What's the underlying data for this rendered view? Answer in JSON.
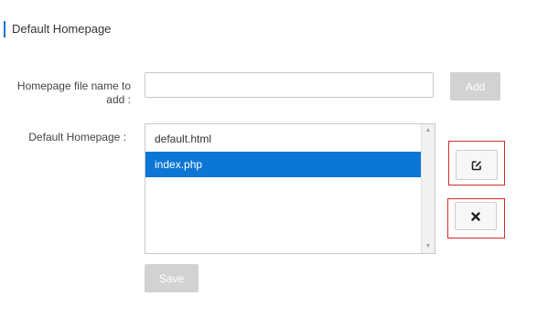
{
  "section": {
    "title": "Default Homepage"
  },
  "form": {
    "filename_label": "Homepage file name to add :",
    "filename_value": "",
    "filename_placeholder": "",
    "add_label": "Add",
    "default_label": "Default Homepage :",
    "homepages": [
      {
        "name": "default.html",
        "selected": false
      },
      {
        "name": "index.php",
        "selected": true
      }
    ],
    "save_label": "Save"
  },
  "actions": {
    "edit_icon": "edit-icon",
    "delete_icon": "close-icon"
  },
  "colors": {
    "accent": "#1a73c8",
    "selection": "#0c76d4",
    "disabled_button": "#d2d2d2",
    "highlight_border": "#d42a2a"
  }
}
